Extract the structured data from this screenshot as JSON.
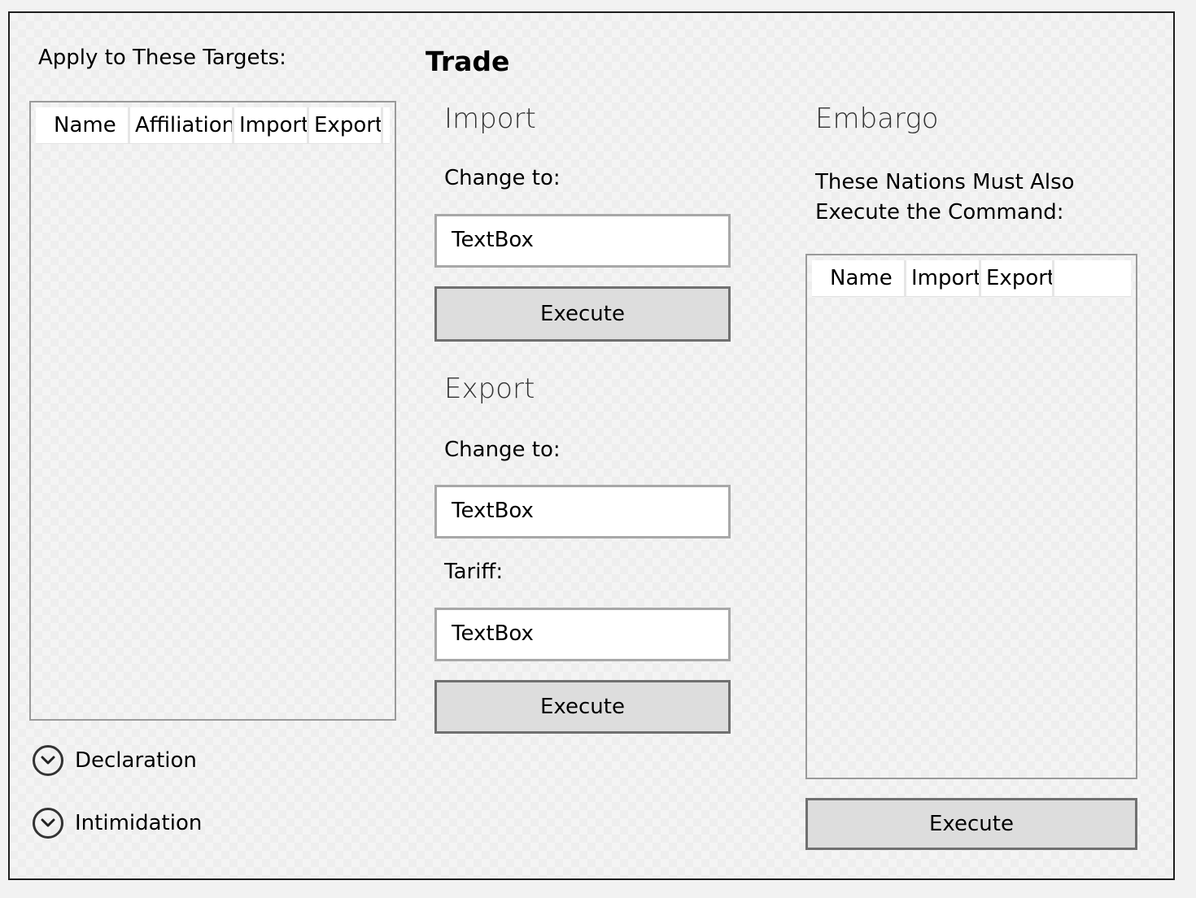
{
  "left": {
    "targets_label": "Apply to These Targets:",
    "targets_columns": [
      "Name",
      "Affiliation",
      "Import",
      "Export"
    ],
    "expanders": [
      {
        "label": "Declaration",
        "icon": "chevron-down-icon"
      },
      {
        "label": "Intimidation",
        "icon": "chevron-down-icon"
      }
    ]
  },
  "trade": {
    "title": "Trade",
    "import": {
      "heading": "Import",
      "change_label": "Change to:",
      "change_value": "TextBox",
      "execute_label": "Execute"
    },
    "export": {
      "heading": "Export",
      "change_label": "Change to:",
      "change_value": "TextBox",
      "tariff_label": "Tariff:",
      "tariff_value": "TextBox",
      "execute_label": "Execute"
    }
  },
  "embargo": {
    "heading": "Embargo",
    "description_line1": "These Nations Must Also",
    "description_line2": "Execute the Command:",
    "columns": [
      "Name",
      "Import",
      "Export"
    ],
    "execute_label": "Execute"
  },
  "colors": {
    "border": "#9a9a9a",
    "button_bg": "#dddddd",
    "button_border": "#707070",
    "textbox_border": "#a8a8a8"
  }
}
